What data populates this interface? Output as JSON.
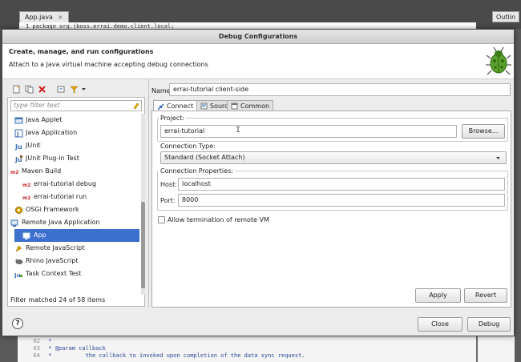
{
  "ide": {
    "editor_tab": "App.java",
    "editor_tab_close": "×",
    "outline_tab": "Outlin",
    "code_line_1": "1  package org.jboss.errai.demo.client.local;",
    "code": [
      {
        "ln": "62",
        "text": " *"
      },
      {
        "ln": "63",
        "text": " * @param callback"
      },
      {
        "ln": "64",
        "text": " *          the callback to invoked upon completion of the data sync request."
      }
    ]
  },
  "dialog": {
    "title": "Debug Configurations",
    "banner_title": "Create, manage, and run configurations",
    "banner_message": "Attach to a Java virtual machine accepting debug connections",
    "filter_placeholder": "type filter text",
    "filter_status": "Filter matched 24 of 58 items",
    "tree": [
      {
        "label": "Java Applet",
        "icon": "java-applet-icon",
        "indent": 1
      },
      {
        "label": "Java Application",
        "icon": "java-application-icon",
        "indent": 1
      },
      {
        "label": "JUnit",
        "icon": "junit-icon",
        "indent": 1
      },
      {
        "label": "JUnit Plug-in Test",
        "icon": "junit-plugin-icon",
        "indent": 1
      },
      {
        "label": "Maven Build",
        "icon": "maven-icon",
        "indent": 0,
        "expanded": true
      },
      {
        "label": "errai-tutorial debug",
        "icon": "maven-icon",
        "indent": 2
      },
      {
        "label": "errai-tutorial run",
        "icon": "maven-icon",
        "indent": 2
      },
      {
        "label": "OSGi Framework",
        "icon": "osgi-icon",
        "indent": 1
      },
      {
        "label": "Remote Java Application",
        "icon": "remote-java-icon",
        "indent": 0,
        "expanded": true
      },
      {
        "label": "App",
        "icon": "remote-java-icon",
        "indent": 2,
        "selected": true
      },
      {
        "label": "Remote JavaScript",
        "icon": "remote-javascript-icon",
        "indent": 1
      },
      {
        "label": "Rhino JavaScript",
        "icon": "rhino-icon",
        "indent": 1
      },
      {
        "label": "Task Context Test",
        "icon": "task-context-icon",
        "indent": 1
      }
    ],
    "name_label": "Name:",
    "name_value": "errai-tutorial client-side",
    "tabs": [
      {
        "label": "Connect",
        "icon": "connect-icon",
        "active": true
      },
      {
        "label": "Source",
        "icon": "source-icon",
        "active": false
      },
      {
        "label": "Common",
        "icon": "common-icon",
        "active": false
      }
    ],
    "project_group": "Project:",
    "project_value": "errai-tutorial",
    "browse_label": "Browse...",
    "connection_type_group": "Connection Type:",
    "connection_type_value": "Standard (Socket Attach)",
    "connection_props_group": "Connection Properties:",
    "host_label": "Host:",
    "host_value": "localhost",
    "port_label": "Port:",
    "port_value": "8000",
    "allow_termination_label": "Allow termination of remote VM",
    "apply_label": "Apply",
    "revert_label": "Revert",
    "close_label": "Close",
    "debug_label": "Debug",
    "help_label": "?"
  },
  "colors": {
    "selection": "#3d6fcf",
    "maven_red": "#c8282d",
    "java_blue": "#3b6fb6",
    "bug_green": "#5aa02c"
  }
}
